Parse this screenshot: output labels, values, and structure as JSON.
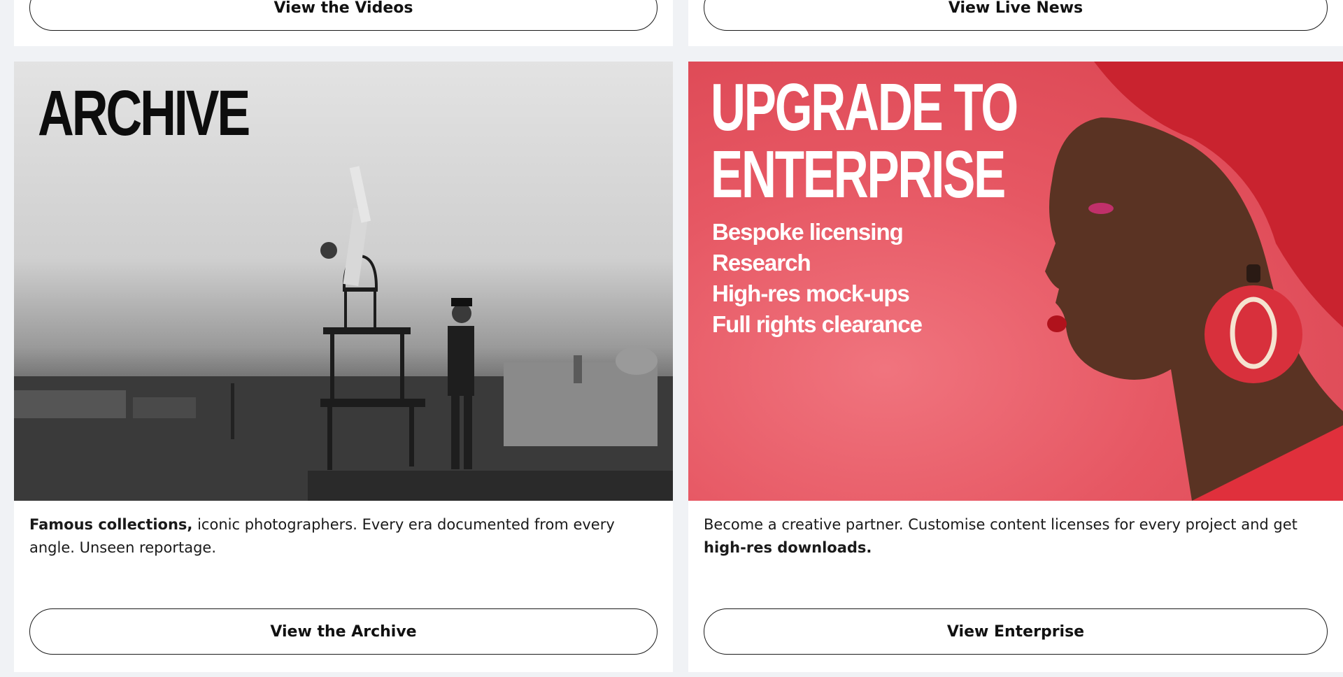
{
  "top_cards": {
    "left_button": "View the Videos",
    "right_button": "View Live News"
  },
  "archive": {
    "title": "ARCHIVE",
    "desc_bold": "Famous collections,",
    "desc_rest": " iconic photographers. Every era documented from every angle. Unseen reportage.",
    "button": "View the Archive"
  },
  "enterprise": {
    "title_line1": "UPGRADE TO",
    "title_line2": "ENTERPRISE",
    "bullets": [
      "Bespoke licensing",
      "Research",
      "High-res mock-ups",
      "Full rights clearance"
    ],
    "desc_rest": "Become a creative partner. Customise content licenses for every project and get ",
    "desc_bold": "high-res downloads.",
    "button": "View Enterprise"
  },
  "colors": {
    "page_bg": "#f0f2f5",
    "enterprise_red": "#e65763",
    "text": "#1a1a1a"
  }
}
